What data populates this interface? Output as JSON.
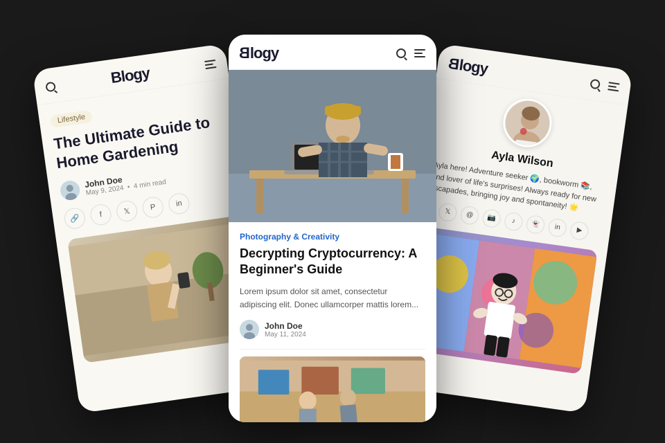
{
  "app": {
    "name": "Blogy"
  },
  "left_card": {
    "logo": "Blogy",
    "category": "Lifestyle",
    "title": "The Ultimate Guide to Home Gardening",
    "author_name": "John Doe",
    "author_date": "May 9, 2024",
    "author_meta": "4 min read",
    "socials": [
      "🔗",
      "f",
      "𝕏",
      "𝒫",
      "in"
    ]
  },
  "center_card": {
    "logo": "Blogy",
    "category": "Photography & Creativity",
    "title": "Decrypting Cryptocurrency: A Beginner's Guide",
    "excerpt": "Lorem ipsum dolor sit amet, consectetur adipiscing elit. Donec ullamcorper mattis lorem...",
    "author_name": "John Doe",
    "author_date": "May 11, 2024"
  },
  "right_card": {
    "logo": "Blogy",
    "profile_name": "Ayla Wilson",
    "profile_bio": "Ayla here! Adventure seeker 🌍, bookworm 📚, and lover of life's surprises! Always ready for new escapades, bringing joy and spontaneity! 🌟",
    "socials": [
      "𝕏",
      "Ⓖ",
      "📷",
      "♪",
      "👻",
      "in",
      "▶"
    ]
  },
  "author_detection": {
    "text": "John Doc May 2024"
  }
}
